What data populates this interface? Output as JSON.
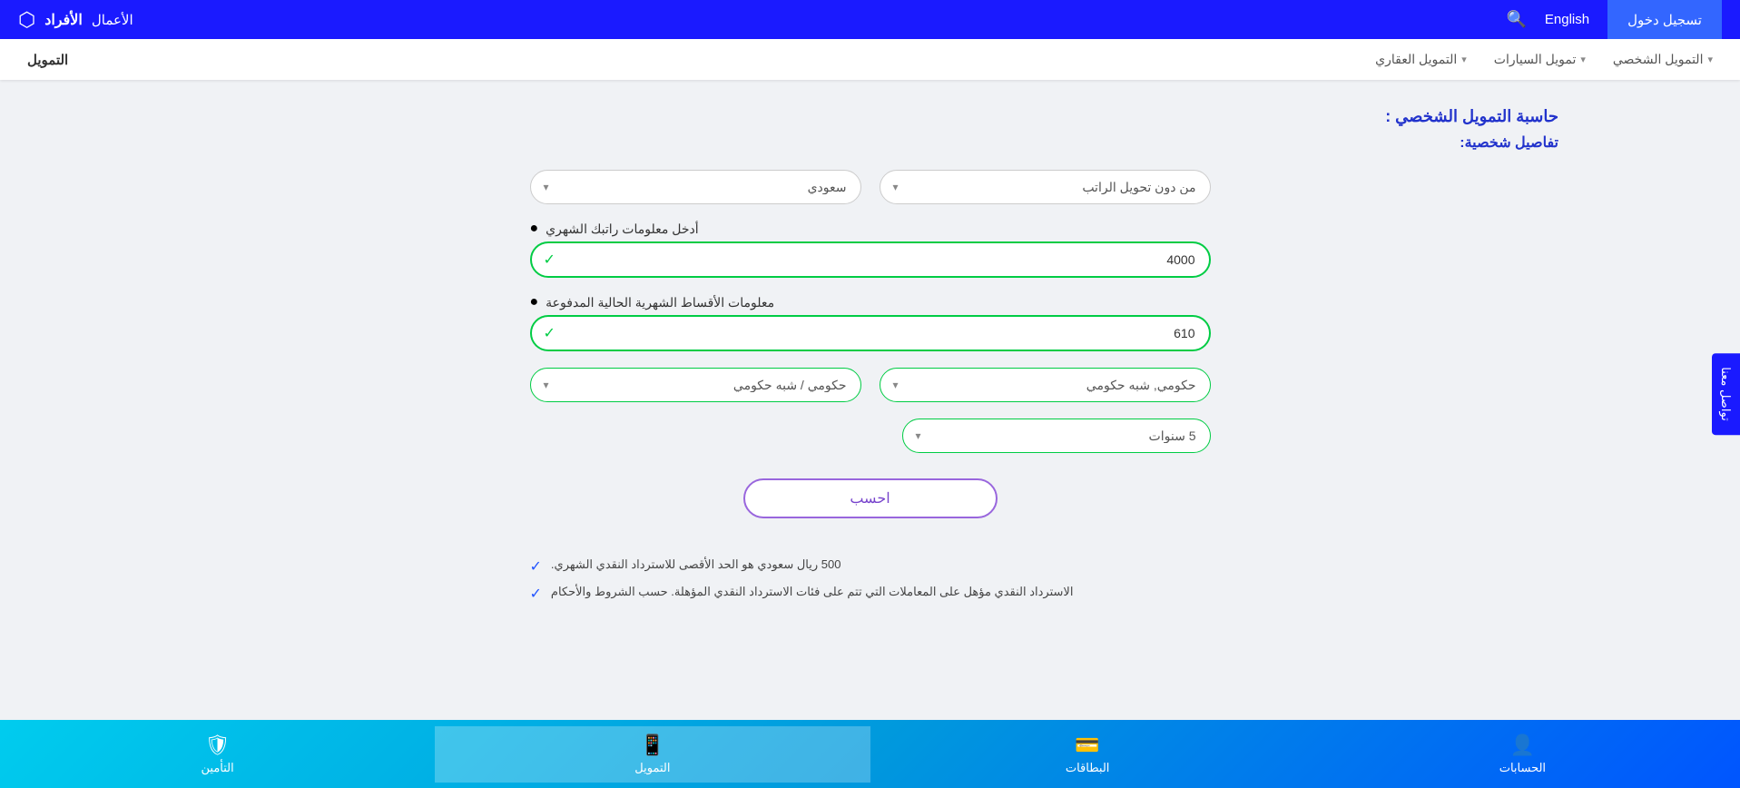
{
  "topNav": {
    "loginLabel": "تسجيل دخول",
    "englishLabel": "English",
    "brandName": "الأفراد",
    "businessLabel": "الأعمال",
    "searchIcon": "🔍",
    "logoIcon": "⬡"
  },
  "subNav": {
    "financingLabel": "التمويل",
    "realEstateLabel": "التمويل العقاري",
    "realEstateChevron": "▾",
    "carsLabel": "تمويل السيارات",
    "carsChevron": "▾",
    "personalLabel": "التمويل الشخصي",
    "personalChevron": "▾"
  },
  "pageTitle": "حاسبة التمويل الشخصي :",
  "sectionTitle": "تفاصيل شخصية:",
  "form": {
    "nationalityPlaceholder": "سعودي",
    "salaryTransferPlaceholder": "من دون تحويل الراتب",
    "salaryLabel": "أدخل معلومات راتبك الشهري",
    "salaryValue": "4000",
    "installmentLabel": "معلومات الأقساط الشهرية الحالية المدفوعة",
    "installmentValue": "610",
    "employerSectorPlaceholder": "حكومي, شبه حكومي",
    "employerTypePlaceholder": "حكومي / شبه حكومي",
    "durationPlaceholder": "5 سنوات",
    "calculateLabel": "احسب"
  },
  "notes": [
    "500 ريال سعودي هو الحد الأقصى للاسترداد النقدي الشهري.",
    "الاسترداد النقدي مؤهل على المعاملات التي تتم على فئات الاسترداد النقدي المؤهلة. حسب الشروط والأحكام"
  ],
  "bottomTabs": [
    {
      "label": "الحسابات",
      "icon": "👤",
      "active": false
    },
    {
      "label": "البطاقات",
      "icon": "💳",
      "active": false
    },
    {
      "label": "التمويل",
      "icon": "📱",
      "active": true
    },
    {
      "label": "التأمين",
      "icon": "🛡",
      "active": false
    }
  ],
  "sideButton": "تواصل معنا"
}
